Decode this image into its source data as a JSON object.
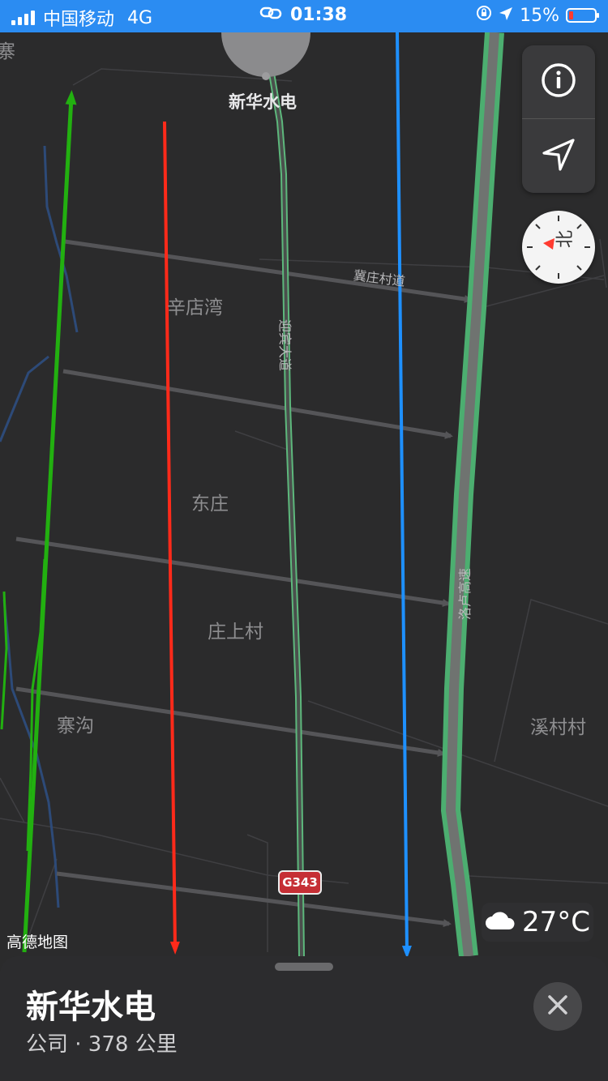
{
  "status_bar": {
    "carrier": "中国移动",
    "network": "4G",
    "time": "01:38",
    "battery_percent": "15%",
    "battery_level": 0.15
  },
  "map": {
    "pin_label": "新华水电",
    "places": [
      "辛店湾",
      "东庄",
      "庄上村",
      "寨沟",
      "溪村村",
      "寨"
    ],
    "road_labels": [
      "迎宾大道",
      "冀庄村道",
      "洛卢高速"
    ],
    "route_shield": "G343",
    "attribution": "高德地图",
    "weather": {
      "icon": "cloud-icon",
      "temperature": "27°C"
    },
    "compass_glyph": "北",
    "colors": {
      "background": "#2b2b2c",
      "highway": "#4cae70",
      "red_line": "#ff2a1a",
      "blue_line": "#1e90ff",
      "green_line": "#22b010",
      "arrow": "#555558"
    }
  },
  "controls": {
    "info_icon": "info-icon",
    "location_icon": "location-arrow-icon"
  },
  "sheet": {
    "title": "新华水电",
    "subtitle": "公司 · 378 公里",
    "close_icon": "close-icon"
  }
}
